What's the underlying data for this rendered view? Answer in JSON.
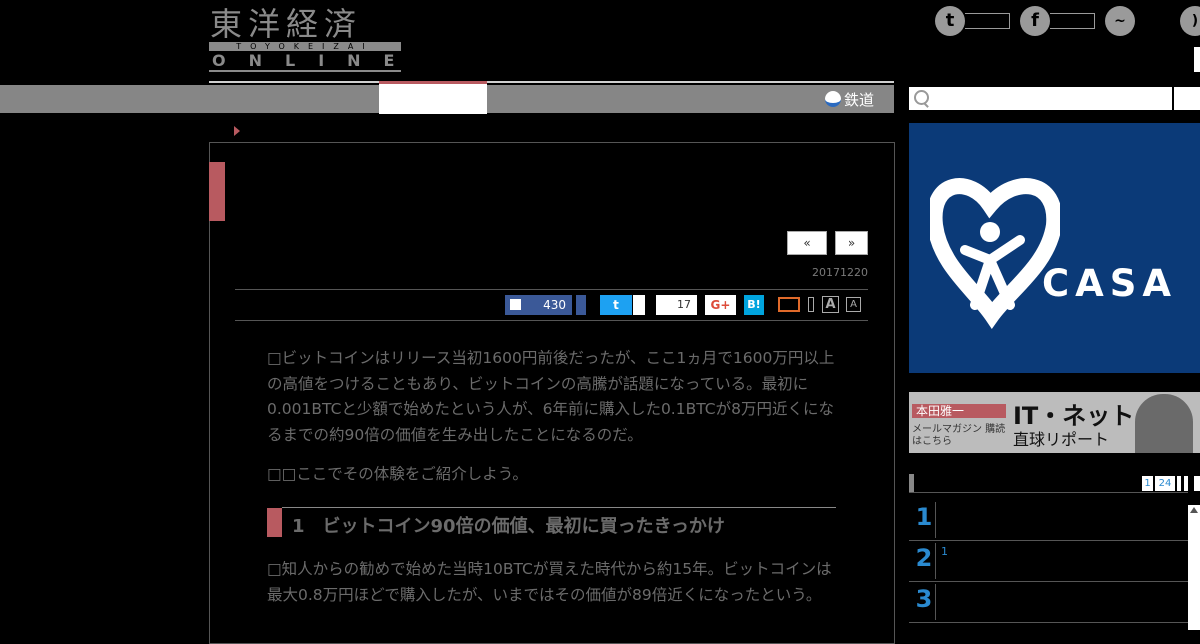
{
  "logo": {
    "jp": "東洋経済",
    "band": "TOYOKEIZAI",
    "online": "ONLINE"
  },
  "nav": {
    "rail_label": "鉄道",
    "search_placeholder": ""
  },
  "article": {
    "pager_prev": "«",
    "pager_next": "»",
    "date": "20171220",
    "share": {
      "like_count": "430",
      "twitter_count": "17",
      "gplus": "G+",
      "hatena": "B!"
    },
    "font_large": "A",
    "font_small": "A",
    "paragraphs": [
      "1600 1600 0.001BTC 6 0.1BTC 8 90",
      ""
    ],
    "p1": "□ビットコインはリリース当初1600円前後だったが、ここ1ヵ月で1600万円以上の高値をつけることもあり、ビットコインの高騰が話題になっている。最初に0.001BTCと少額で始めたという人が、6年前に購入した0.1BTCが8万円近くになるまでの約90倍の価値を生み出したことになるのだ。",
    "p2": "□□ここでその体験をご紹介しよう。",
    "h2": "1　ビットコイン90倍の価値、最初に買ったきっかけ",
    "p3": "□知人からの勧めで始めた当時10BTCが買えた時代から約15年。ビットコインは最大0.8万円ほどで購入したが、いまではその価値が89倍近くになったという。"
  },
  "sidebar": {
    "casa_text": "CASA",
    "banner2_name": "本田雅一",
    "banner2_title": "IT・ネット",
    "banner2_sub": "直球リポート",
    "banner2_mail": "メールマガジン 購読はこちら",
    "rank_tabs": [
      "1",
      "24"
    ],
    "ranks": [
      {
        "num": "1",
        "text": ""
      },
      {
        "num": "2",
        "text": "1"
      },
      {
        "num": "3",
        "text": ""
      }
    ]
  },
  "colors": {
    "accent": "#b85a60",
    "fb": "#3b5998",
    "twitter": "#1da1f2",
    "casa": "#0b3a78"
  }
}
